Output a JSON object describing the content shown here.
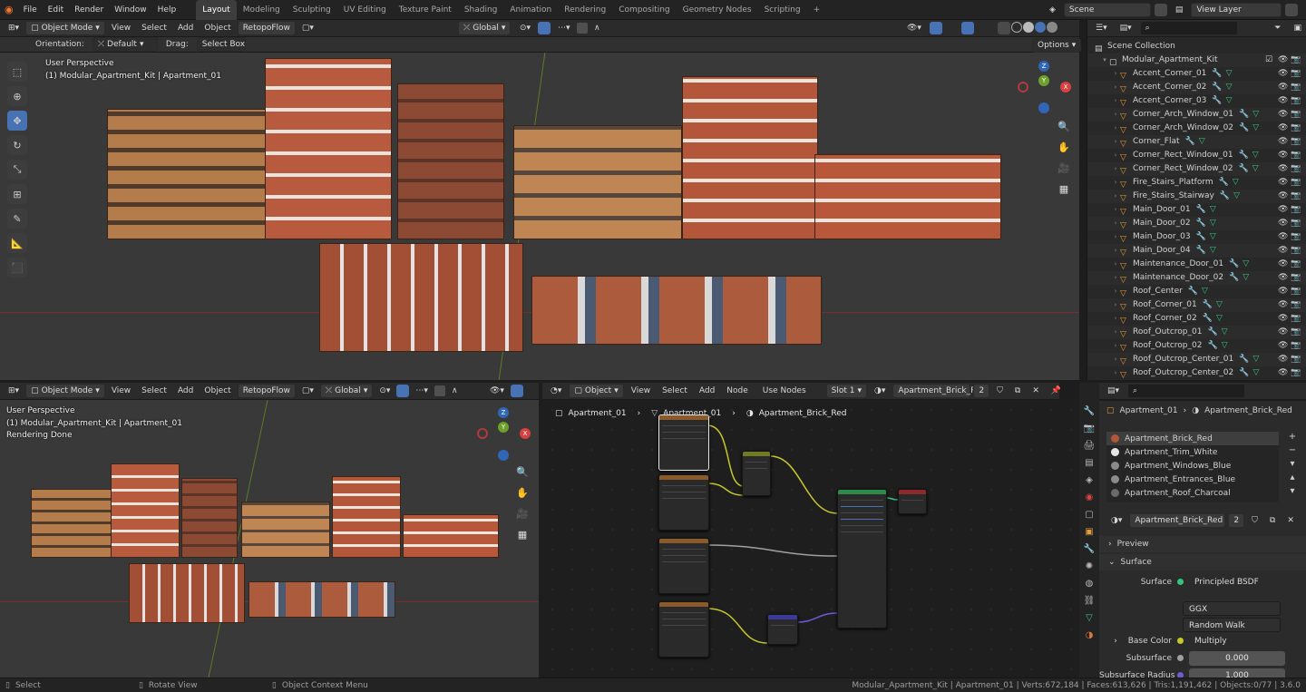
{
  "topbar": {
    "menus": [
      "File",
      "Edit",
      "Render",
      "Window",
      "Help"
    ],
    "workspaces": [
      "Layout",
      "Modeling",
      "Sculpting",
      "UV Editing",
      "Texture Paint",
      "Shading",
      "Animation",
      "Rendering",
      "Compositing",
      "Geometry Nodes",
      "Scripting"
    ],
    "add_tab": "+",
    "scene": "Scene",
    "view_layer": "View Layer"
  },
  "viewport_top": {
    "mode": "Object Mode",
    "menus": [
      "View",
      "Select",
      "Add",
      "Object"
    ],
    "addon": "RetopoFlow",
    "transform": "Global",
    "orientation_label": "Orientation:",
    "orientation_value": "Default",
    "drag_label": "Drag:",
    "drag_value": "Select Box",
    "options": "Options",
    "overlay_line1": "User Perspective",
    "overlay_line2": "(1) Modular_Apartment_Kit | Apartment_01",
    "gizmo_z": "Z",
    "gizmo_x": "X",
    "gizmo_y": "Y"
  },
  "outliner": {
    "root": "Scene Collection",
    "collection": "Modular_Apartment_Kit",
    "items": [
      "Accent_Corner_01",
      "Accent_Corner_02",
      "Accent_Corner_03",
      "Corner_Arch_Window_01",
      "Corner_Arch_Window_02",
      "Corner_Flat",
      "Corner_Rect_Window_01",
      "Corner_Rect_Window_02",
      "Fire_Stairs_Platform",
      "Fire_Stairs_Stairway",
      "Main_Door_01",
      "Main_Door_02",
      "Main_Door_03",
      "Main_Door_04",
      "Maintenance_Door_01",
      "Maintenance_Door_02",
      "Roof_Center",
      "Roof_Corner_01",
      "Roof_Corner_02",
      "Roof_Outcrop_01",
      "Roof_Outcrop_02",
      "Roof_Outcrop_Center_01",
      "Roof_Outcrop_Center_02"
    ]
  },
  "viewport_bottom": {
    "mode": "Object Mode",
    "menus": [
      "View",
      "Select",
      "Add",
      "Object"
    ],
    "addon": "RetopoFlow",
    "transform": "Global",
    "overlay_line1": "User Perspective",
    "overlay_line2": "(1) Modular_Apartment_Kit | Apartment_01",
    "overlay_line3": "Rendering Done",
    "gizmo_z": "Z",
    "gizmo_x": "X",
    "gizmo_y": "Y"
  },
  "node_editor": {
    "type": "Object",
    "menus": [
      "View",
      "Select",
      "Add",
      "Node"
    ],
    "use_nodes": "Use Nodes",
    "slot": "Slot 1",
    "material": "Apartment_Brick_Red",
    "users": "2",
    "breadcrumb": [
      "Apartment_01",
      "Apartment_01",
      "Apartment_Brick_Red"
    ]
  },
  "properties": {
    "breadcrumb": [
      "Apartment_01",
      "Apartment_Brick_Red"
    ],
    "materials": [
      "Apartment_Brick_Red",
      "Apartment_Trim_White",
      "Apartment_Windows_Blue",
      "Apartment_Entrances_Blue",
      "Apartment_Roof_Charcoal"
    ],
    "material_colors": [
      "#b0573a",
      "#e6e6e6",
      "#8a8a8a",
      "#8a8a8a",
      "#6a6a6a"
    ],
    "selected_material": "Apartment_Brick_Red",
    "users": "2",
    "panel_preview": "Preview",
    "panel_surface": "Surface",
    "surface_label": "Surface",
    "surface_value": "Principled BSDF",
    "distribution": "GGX",
    "subsurface_method": "Random Walk",
    "base_color_label": "Base Color",
    "base_color_value": "Multiply",
    "subsurface_label": "Subsurface",
    "subsurface_value": "0.000",
    "subsurface_radius_label": "Subsurface Radius",
    "subsurface_radius_value": "1.000"
  },
  "statusbar": {
    "select": "Select",
    "rotate": "Rotate View",
    "context": "Object Context Menu",
    "stats": "Modular_Apartment_Kit | Apartment_01 | Verts:672,184 | Faces:613,626 | Tris:1,191,462 | Objects:0/77 | 3.6.0"
  },
  "colors": {
    "accent": "#4772b3",
    "viewport_bg": "#393939",
    "object_icon": "#e89c3a"
  }
}
